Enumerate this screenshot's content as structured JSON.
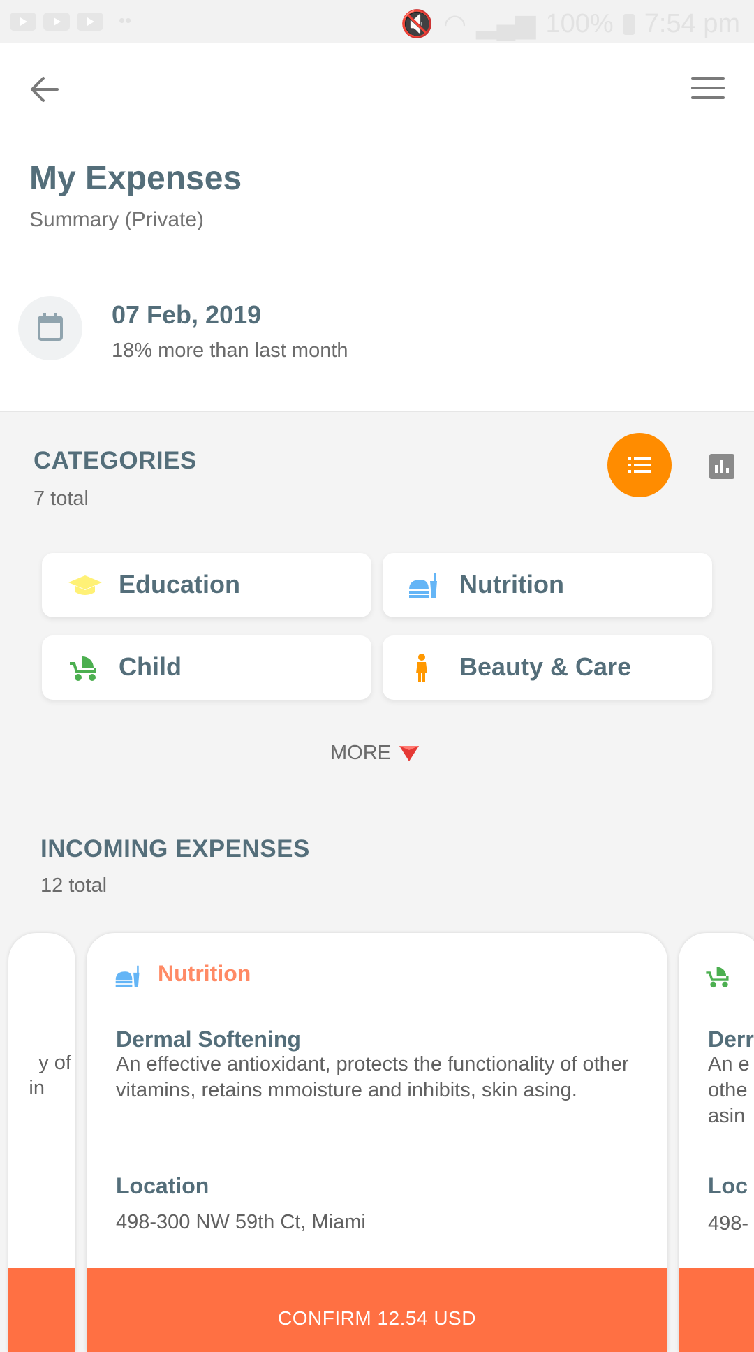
{
  "status_bar": {
    "battery": "100%",
    "time": "7:54 pm"
  },
  "header": {
    "title": "My Expenses",
    "subtitle": "Summary (Private)",
    "date": "07 Feb, 2019",
    "comparison": "18% more than last month"
  },
  "categories": {
    "title": "CATEGORIES",
    "count": "7 total",
    "items": [
      {
        "label": "Education",
        "icon": "graduation-cap-icon",
        "color": "#fff176"
      },
      {
        "label": "Nutrition",
        "icon": "food-icon",
        "color": "#64b5f6"
      },
      {
        "label": "Child",
        "icon": "stroller-icon",
        "color": "#4caf50"
      },
      {
        "label": "Beauty & Care",
        "icon": "woman-icon",
        "color": "#ff9800"
      }
    ],
    "more_label": "MORE"
  },
  "incoming": {
    "title": "INCOMING EXPENSES",
    "count": "12 total",
    "left_card": {
      "line1": "y of",
      "line2": "in"
    },
    "main_card": {
      "category": "Nutrition",
      "name": "Dermal Softening",
      "description": "An effective antioxidant, protects the functionality of other vitamins, retains mmoisture and inhibits, skin asing.",
      "location_label": "Location",
      "location": "498-300 NW 59th Ct, Miami",
      "confirm_label": "CONFIRM 12.54 USD"
    },
    "right_card": {
      "name": "Derr",
      "line1": "An e",
      "line2": "othe",
      "line3": "asin",
      "location_label": "Loc",
      "location": "498-"
    }
  },
  "colors": {
    "accent": "#ff8c00",
    "confirm": "#ff7043",
    "category_text": "#ff8a65",
    "heading": "#546e7a"
  }
}
